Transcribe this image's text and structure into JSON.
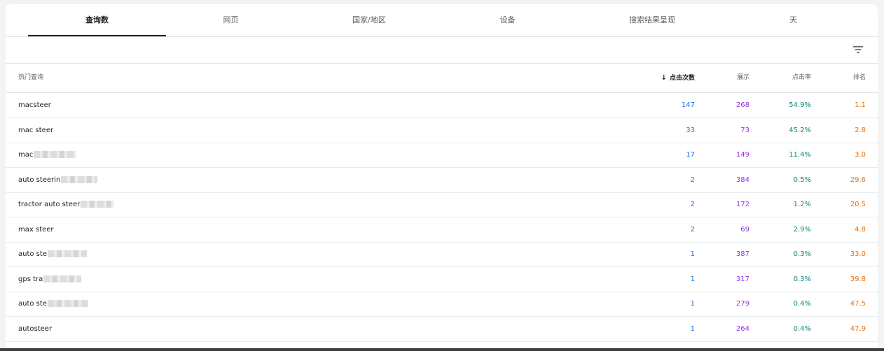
{
  "tabs": [
    {
      "label": "查询数",
      "active": true
    },
    {
      "label": "网页",
      "active": false
    },
    {
      "label": "国家/地区",
      "active": false
    },
    {
      "label": "设备",
      "active": false
    },
    {
      "label": "搜索结果呈现",
      "active": false
    },
    {
      "label": "天",
      "active": false
    }
  ],
  "filter": {
    "icon": "filter-icon"
  },
  "table": {
    "headers": {
      "query": "热门查询",
      "clicks": "点击次数",
      "impressions": "展示",
      "ctr": "点击率",
      "position": "排名",
      "sort_icon": "arrow-down-icon"
    },
    "rows": [
      {
        "query": "macsteer",
        "redacted": false,
        "clicks": "147",
        "impressions": "268",
        "ctr": "54.9%",
        "position": "1.1"
      },
      {
        "query": "mac steer",
        "redacted": false,
        "clicks": "33",
        "impressions": "73",
        "ctr": "45.2%",
        "position": "2.8"
      },
      {
        "query": "mac",
        "redacted": true,
        "clicks": "17",
        "impressions": "149",
        "ctr": "11.4%",
        "position": "3.0"
      },
      {
        "query": "auto steerin",
        "redacted": true,
        "clicks": "2",
        "impressions": "384",
        "ctr": "0.5%",
        "position": "29.6"
      },
      {
        "query": "tractor auto steer",
        "redacted": true,
        "clicks": "2",
        "impressions": "172",
        "ctr": "1.2%",
        "position": "20.5"
      },
      {
        "query": "max steer",
        "redacted": false,
        "clicks": "2",
        "impressions": "69",
        "ctr": "2.9%",
        "position": "4.8"
      },
      {
        "query": "auto ste",
        "redacted": true,
        "clicks": "1",
        "impressions": "387",
        "ctr": "0.3%",
        "position": "33.0"
      },
      {
        "query": "gps tra",
        "redacted": true,
        "clicks": "1",
        "impressions": "317",
        "ctr": "0.3%",
        "position": "39.8"
      },
      {
        "query": "auto ste",
        "redacted": true,
        "clicks": "1",
        "impressions": "279",
        "ctr": "0.4%",
        "position": "47.5"
      },
      {
        "query": "autosteer",
        "redacted": false,
        "clicks": "1",
        "impressions": "264",
        "ctr": "0.4%",
        "position": "47.9"
      }
    ]
  },
  "colors": {
    "clicks": "#1a73e8",
    "impressions": "#9334e6",
    "ctr": "#12857b",
    "position": "#e8710a",
    "active_tab": "#202124"
  }
}
